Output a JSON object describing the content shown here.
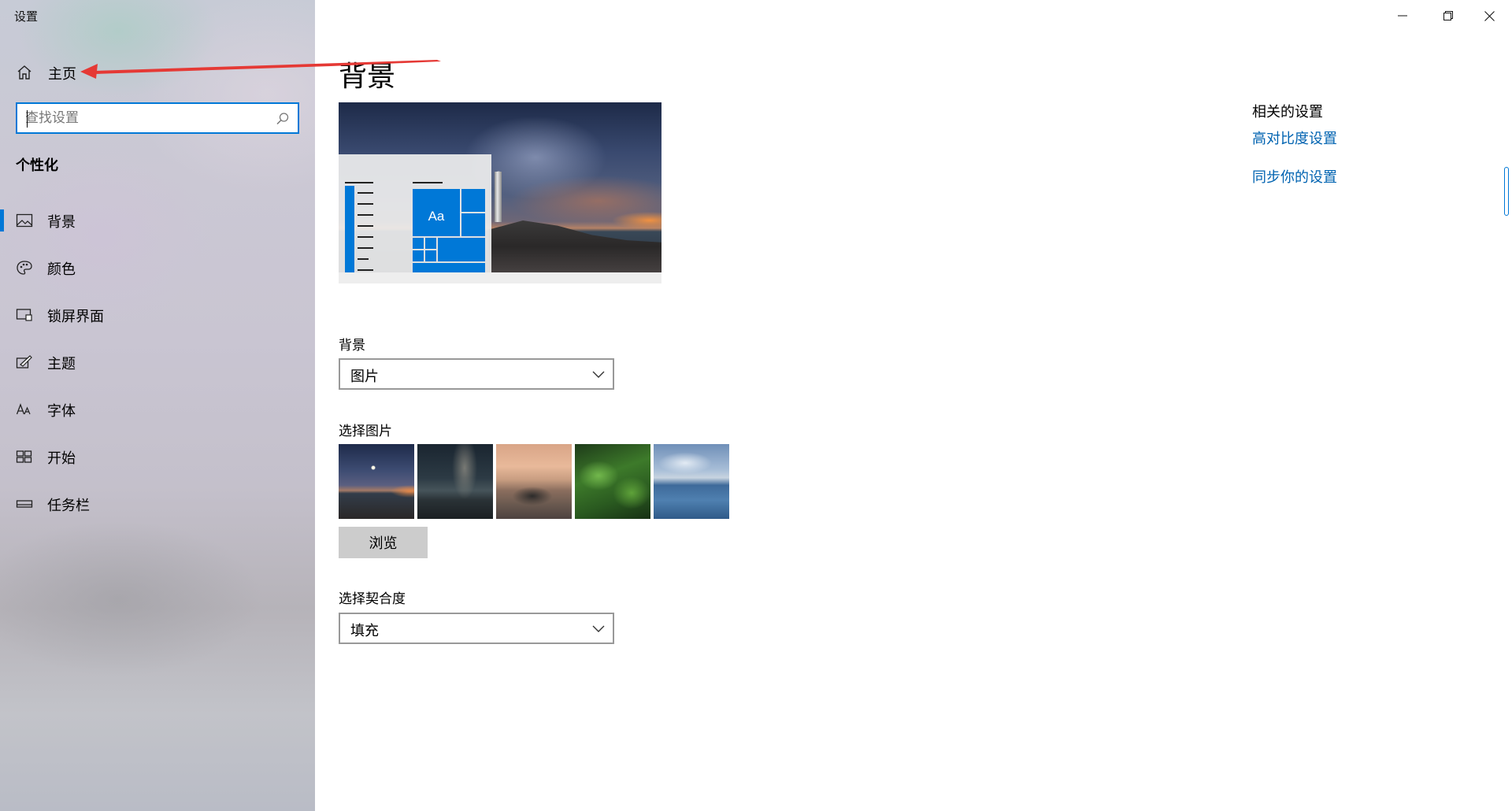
{
  "window": {
    "app_title": "设置",
    "controls": [
      "minimize-icon",
      "restore-icon",
      "close-icon"
    ]
  },
  "sidebar": {
    "home_label": "主页",
    "search_placeholder": "查找设置",
    "section_heading": "个性化",
    "items": [
      {
        "label": "背景",
        "icon": "picture-icon",
        "selected": true
      },
      {
        "label": "颜色",
        "icon": "palette-icon",
        "selected": false
      },
      {
        "label": "锁屏界面",
        "icon": "lock-screen-icon",
        "selected": false
      },
      {
        "label": "主题",
        "icon": "brush-icon",
        "selected": false
      },
      {
        "label": "字体",
        "icon": "font-icon",
        "selected": false
      },
      {
        "label": "开始",
        "icon": "start-icon",
        "selected": false
      },
      {
        "label": "任务栏",
        "icon": "taskbar-icon",
        "selected": false
      }
    ]
  },
  "main": {
    "title": "背景",
    "preview_tile_text": "Aa",
    "background_label": "背景",
    "background_value": "图片",
    "choose_picture_label": "选择图片",
    "thumbnails": [
      "lighthouse",
      "milky-way-lake",
      "sports-car-desert",
      "green-leaves",
      "lake-clouds"
    ],
    "browse_label": "浏览",
    "fit_label": "选择契合度",
    "fit_value": "填充"
  },
  "related": {
    "title": "相关的设置",
    "links": [
      "高对比度设置",
      "同步你的设置"
    ]
  },
  "colors": {
    "accent": "#0078d7",
    "link": "#0063b1",
    "annotation_arrow": "#e53935"
  }
}
